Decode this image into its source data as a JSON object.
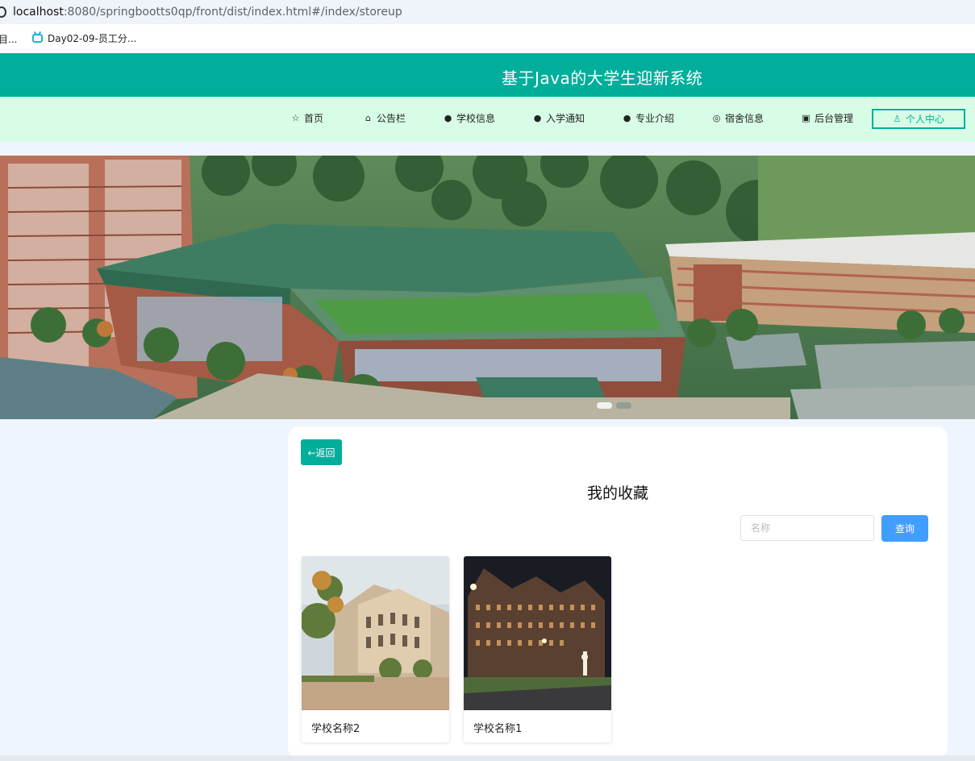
{
  "browser": {
    "url_host": "localhost",
    "url_path": ":8080/springbootts0qp/front/dist/index.html#/index/storeup",
    "bookmarks": [
      {
        "label": "目..."
      },
      {
        "label": "Day02-09-员工分..."
      }
    ]
  },
  "header": {
    "title": "基于Java的大学生迎新系统",
    "brand_color": "#00ae9b",
    "nav_bg": "#d8fde6"
  },
  "nav": [
    {
      "label": "首页",
      "icon": "star-icon"
    },
    {
      "label": "公告栏",
      "icon": "bag-icon"
    },
    {
      "label": "学校信息",
      "icon": "info-icon"
    },
    {
      "label": "入学通知",
      "icon": "question-icon"
    },
    {
      "label": "专业介绍",
      "icon": "info-icon"
    },
    {
      "label": "宿舍信息",
      "icon": "target-icon"
    },
    {
      "label": "后台管理",
      "icon": "briefcase-icon"
    },
    {
      "label": "个人中心",
      "icon": "user-icon"
    }
  ],
  "banner": {
    "active_slide": 1,
    "slide_count": 2
  },
  "main": {
    "back_label": "←返回",
    "title": "我的收藏",
    "search": {
      "placeholder": "名称",
      "value": ""
    },
    "search_button": "查询",
    "items": [
      {
        "name": "学校名称2"
      },
      {
        "name": "学校名称1"
      }
    ]
  }
}
